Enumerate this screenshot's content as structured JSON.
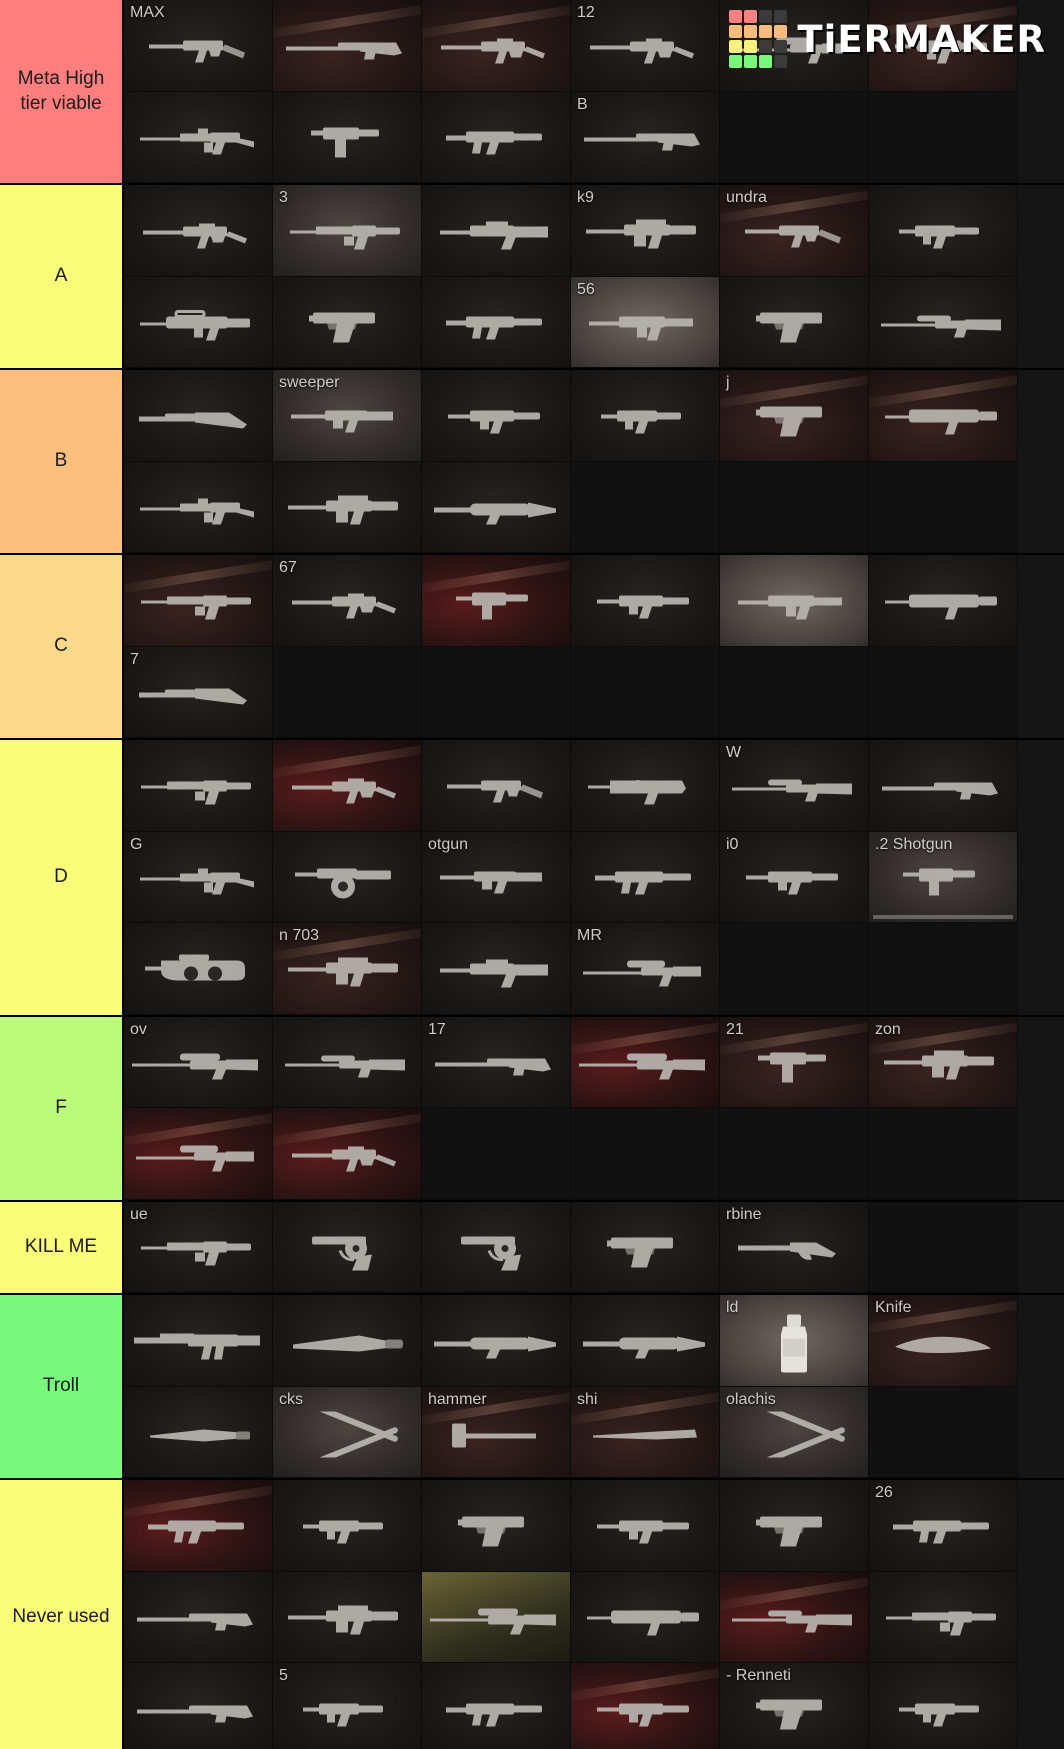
{
  "logo": {
    "wordmark": "TiERMAKER",
    "grid_colors": [
      "#f98080",
      "#f98080",
      "#3b3b3b",
      "#3b3b3b",
      "#f9bc7c",
      "#f9bc7c",
      "#f9bc7c",
      "#f9bc7c",
      "#f6f07c",
      "#f6f07c",
      "#3b3b3b",
      "#3b3b3b",
      "#79f97c",
      "#79f97c",
      "#79f97c",
      "#3b3b3b"
    ]
  },
  "tiers": [
    {
      "label": "Meta High tier viable",
      "color": "#ff7f7f",
      "items": [
        {
          "label": "MAX",
          "gun": "ak-compact",
          "style": "plain"
        },
        {
          "label": "",
          "gun": "rifle-long",
          "style": "warm"
        },
        {
          "label": "",
          "gun": "ak-rifle",
          "style": "warm"
        },
        {
          "label": "12",
          "gun": "ak-rifle",
          "style": "plain"
        },
        {
          "label": "",
          "gun": "rifle-scope",
          "style": "plain"
        },
        {
          "label": "",
          "gun": "smg",
          "style": "warm"
        },
        {
          "label": "",
          "gun": "m16",
          "style": "plain"
        },
        {
          "label": "",
          "gun": "uzi",
          "style": "plain"
        },
        {
          "label": "",
          "gun": "mp5",
          "style": "plain"
        },
        {
          "label": "B",
          "gun": "rifle-long",
          "style": "plain"
        },
        {
          "label": "",
          "gun": "",
          "style": "empty"
        },
        {
          "label": "",
          "gun": "",
          "style": "empty"
        }
      ]
    },
    {
      "label": "A",
      "color": "#fbfb7a",
      "items": [
        {
          "label": "",
          "gun": "ak-rifle",
          "style": "plain"
        },
        {
          "label": "3",
          "gun": "ar-rail",
          "style": "lit"
        },
        {
          "label": "",
          "gun": "scar",
          "style": "plain"
        },
        {
          "label": "k9",
          "gun": "lmg",
          "style": "plain"
        },
        {
          "label": "undra",
          "gun": "ak-compact",
          "style": "warm"
        },
        {
          "label": "",
          "gun": "mp7",
          "style": "plain"
        },
        {
          "label": "",
          "gun": "famas",
          "style": "plain"
        },
        {
          "label": "",
          "gun": "pistol",
          "style": "plain"
        },
        {
          "label": "",
          "gun": "mp5",
          "style": "plain"
        },
        {
          "label": "56",
          "gun": "galil",
          "style": "bright"
        },
        {
          "label": "",
          "gun": "pistol",
          "style": "plain"
        },
        {
          "label": "",
          "gun": "boltrifle",
          "style": "plain"
        }
      ]
    },
    {
      "label": "B",
      "color": "#fbbf7c",
      "items": [
        {
          "label": "",
          "gun": "shotgun",
          "style": "plain"
        },
        {
          "label": "sweeper",
          "gun": "autoshotgun",
          "style": "lit"
        },
        {
          "label": "",
          "gun": "smg",
          "style": "plain"
        },
        {
          "label": "",
          "gun": "mp7",
          "style": "plain"
        },
        {
          "label": "j",
          "gun": "pistol",
          "style": "warm"
        },
        {
          "label": "",
          "gun": "bullpup",
          "style": "warm"
        },
        {
          "label": "",
          "gun": "m16",
          "style": "plain"
        },
        {
          "label": "",
          "gun": "lmg",
          "style": "plain"
        },
        {
          "label": "",
          "gun": "rpg",
          "style": "plain"
        },
        {
          "label": "",
          "gun": "",
          "style": "empty"
        },
        {
          "label": "",
          "gun": "",
          "style": "empty"
        },
        {
          "label": "",
          "gun": "",
          "style": "empty"
        }
      ]
    },
    {
      "label": "C",
      "color": "#fcd98a",
      "items": [
        {
          "label": "",
          "gun": "ar-rail",
          "style": "warm"
        },
        {
          "label": "67",
          "gun": "ak-rifle",
          "style": "plain"
        },
        {
          "label": "",
          "gun": "mac10",
          "style": "red"
        },
        {
          "label": "",
          "gun": "smg",
          "style": "plain"
        },
        {
          "label": "",
          "gun": "galil",
          "style": "bright"
        },
        {
          "label": "",
          "gun": "bullpup",
          "style": "plain"
        },
        {
          "label": "7",
          "gun": "shotgun",
          "style": "plain"
        },
        {
          "label": "",
          "gun": "",
          "style": "empty"
        },
        {
          "label": "",
          "gun": "",
          "style": "empty"
        },
        {
          "label": "",
          "gun": "",
          "style": "empty"
        },
        {
          "label": "",
          "gun": "",
          "style": "empty"
        },
        {
          "label": "",
          "gun": "",
          "style": "empty"
        }
      ]
    },
    {
      "label": "D",
      "color": "#fbfb7a",
      "items": [
        {
          "label": "",
          "gun": "ar-rail",
          "style": "plain"
        },
        {
          "label": "",
          "gun": "ak-rifle",
          "style": "red"
        },
        {
          "label": "",
          "gun": "ak-compact",
          "style": "plain"
        },
        {
          "label": "",
          "gun": "aug",
          "style": "plain"
        },
        {
          "label": "W",
          "gun": "boltrifle",
          "style": "plain"
        },
        {
          "label": "",
          "gun": "rifle-long",
          "style": "plain"
        },
        {
          "label": "G",
          "gun": "m16",
          "style": "plain"
        },
        {
          "label": "",
          "gun": "drumgun",
          "style": "plain"
        },
        {
          "label": "otgun",
          "gun": "autoshotgun",
          "style": "plain"
        },
        {
          "label": "",
          "gun": "mp5",
          "style": "plain"
        },
        {
          "label": "i0",
          "gun": "smg",
          "style": "plain"
        },
        {
          "label": ".2 Shotgun",
          "gun": "mac10",
          "style": "lit"
        },
        {
          "label": "",
          "gun": "p90",
          "style": "plain"
        },
        {
          "label": "n 703",
          "gun": "lmg",
          "style": "warm"
        },
        {
          "label": "",
          "gun": "scar",
          "style": "plain"
        },
        {
          "label": "MR",
          "gun": "rifle-scope",
          "style": "plain"
        },
        {
          "label": "",
          "gun": "",
          "style": "empty"
        },
        {
          "label": "",
          "gun": "",
          "style": "empty"
        }
      ]
    },
    {
      "label": "F",
      "color": "#bcfb7a",
      "items": [
        {
          "label": "ov",
          "gun": "sniper",
          "style": "plain"
        },
        {
          "label": "",
          "gun": "boltrifle",
          "style": "plain"
        },
        {
          "label": "17",
          "gun": "rifle-long",
          "style": "plain"
        },
        {
          "label": "",
          "gun": "sniper",
          "style": "red"
        },
        {
          "label": "21",
          "gun": "uzi",
          "style": "warm"
        },
        {
          "label": "zon",
          "gun": "lmg",
          "style": "warm"
        },
        {
          "label": "",
          "gun": "rifle-scope",
          "style": "red"
        },
        {
          "label": "",
          "gun": "ak-rifle",
          "style": "red"
        },
        {
          "label": "",
          "gun": "",
          "style": "empty"
        },
        {
          "label": "",
          "gun": "",
          "style": "empty"
        },
        {
          "label": "",
          "gun": "",
          "style": "empty"
        },
        {
          "label": "",
          "gun": "",
          "style": "empty"
        }
      ]
    },
    {
      "label": "KILL ME",
      "color": "#fbfb7a",
      "items": [
        {
          "label": "ue",
          "gun": "ar-rail",
          "style": "plain"
        },
        {
          "label": "",
          "gun": "revolver",
          "style": "plain"
        },
        {
          "label": "",
          "gun": "revolver",
          "style": "plain"
        },
        {
          "label": "",
          "gun": "pistol",
          "style": "plain"
        },
        {
          "label": "rbine",
          "gun": "leveraction",
          "style": "plain"
        },
        {
          "label": "",
          "gun": "",
          "style": "empty"
        }
      ]
    },
    {
      "label": "Troll",
      "color": "#79f97c",
      "items": [
        {
          "label": "",
          "gun": "barrett",
          "style": "plain"
        },
        {
          "label": "",
          "gun": "machete",
          "style": "plain"
        },
        {
          "label": "",
          "gun": "rpg",
          "style": "plain"
        },
        {
          "label": "",
          "gun": "rpg",
          "style": "plain"
        },
        {
          "label": "ld",
          "gun": "bottle",
          "style": "bright"
        },
        {
          "label": "Knife",
          "gun": "knife-curve",
          "style": "warm"
        },
        {
          "label": "",
          "gun": "knife",
          "style": "plain"
        },
        {
          "label": "cks",
          "gun": "sticks",
          "style": "lit"
        },
        {
          "label": "hammer",
          "gun": "sledge",
          "style": "warm"
        },
        {
          "label": "shi",
          "gun": "bat",
          "style": "warm"
        },
        {
          "label": "olachis",
          "gun": "sticks",
          "style": "lit"
        },
        {
          "label": "",
          "gun": "",
          "style": "empty"
        }
      ]
    },
    {
      "label": "Never used",
      "color": "#fbfb7a",
      "items": [
        {
          "label": "",
          "gun": "mp5",
          "style": "red"
        },
        {
          "label": "",
          "gun": "mp7",
          "style": "plain"
        },
        {
          "label": "",
          "gun": "pistol",
          "style": "plain"
        },
        {
          "label": "",
          "gun": "smg",
          "style": "plain"
        },
        {
          "label": "",
          "gun": "pistol",
          "style": "plain"
        },
        {
          "label": "26",
          "gun": "mp5",
          "style": "plain"
        },
        {
          "label": "",
          "gun": "rifle-long",
          "style": "plain"
        },
        {
          "label": "",
          "gun": "lmg",
          "style": "plain"
        },
        {
          "label": "",
          "gun": "sniper",
          "style": "olive"
        },
        {
          "label": "",
          "gun": "bullpup",
          "style": "plain"
        },
        {
          "label": "",
          "gun": "boltrifle",
          "style": "red"
        },
        {
          "label": "",
          "gun": "ar-rail",
          "style": "plain"
        },
        {
          "label": "",
          "gun": "rifle-long",
          "style": "plain"
        },
        {
          "label": "5",
          "gun": "mp7",
          "style": "plain"
        },
        {
          "label": "",
          "gun": "mp5",
          "style": "plain"
        },
        {
          "label": "",
          "gun": "smg",
          "style": "red"
        },
        {
          "label": "- Renneti",
          "gun": "pistol",
          "style": "plain"
        },
        {
          "label": "",
          "gun": "mp7",
          "style": "plain"
        }
      ]
    }
  ]
}
